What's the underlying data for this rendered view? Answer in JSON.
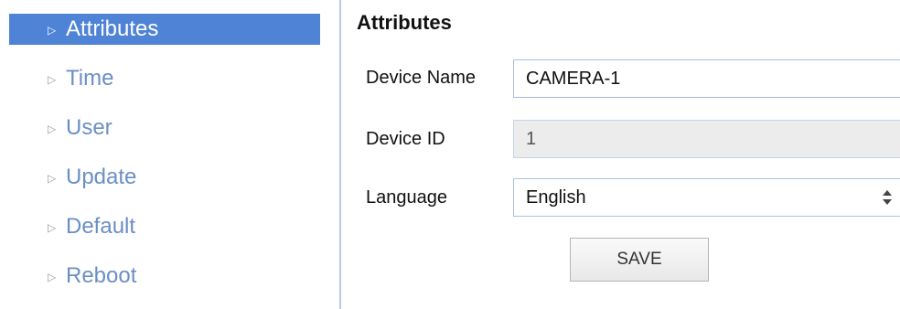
{
  "sidebar": {
    "arrow_glyph": "▷",
    "items": [
      {
        "label": "Attributes",
        "active": true
      },
      {
        "label": "Time"
      },
      {
        "label": "User"
      },
      {
        "label": "Update"
      },
      {
        "label": "Default"
      },
      {
        "label": "Reboot"
      }
    ]
  },
  "main": {
    "title": "Attributes",
    "device_name": {
      "label": "Device Name",
      "value": "CAMERA-1"
    },
    "device_id": {
      "label": "Device ID",
      "value": "1"
    },
    "language": {
      "label": "Language",
      "selected": "English"
    },
    "save_label": "SAVE"
  },
  "colors": {
    "active_bg": "#4f83d6",
    "nav_text": "#6a8fc5",
    "divider": "#b9c9e6",
    "input_border": "#a8c0e3"
  },
  "icons": {
    "nav_arrow": "triangle-right-icon",
    "select_arrows": "updown-arrows-icon"
  }
}
